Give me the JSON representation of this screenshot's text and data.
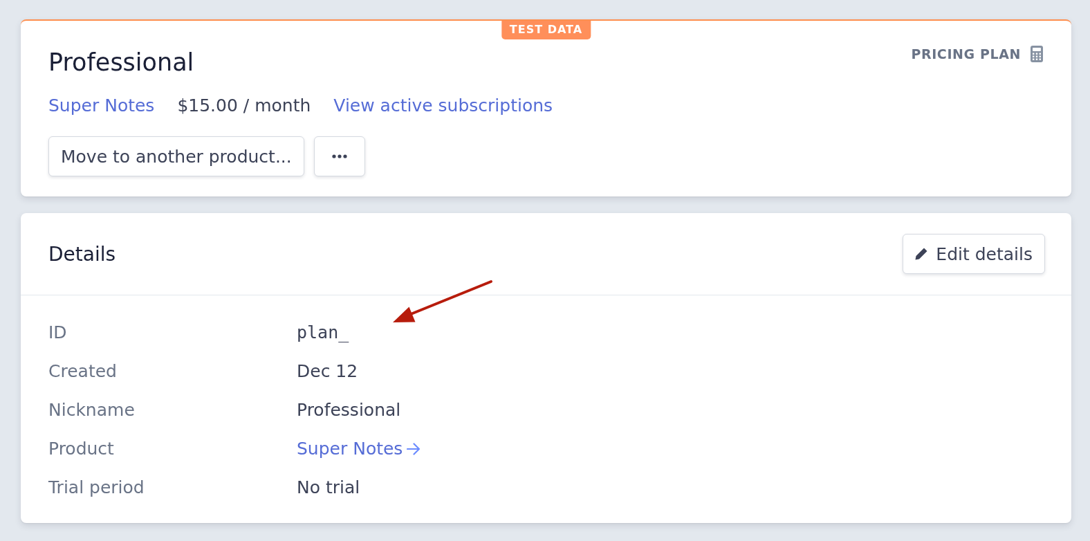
{
  "badge": "TEST DATA",
  "plan": {
    "name": "Professional",
    "type_label": "PRICING PLAN",
    "product_link": "Super Notes",
    "price": "$15.00 / month",
    "subscriptions_link": "View active subscriptions",
    "buttons": [
      {
        "kind": "text",
        "label": "Move to another product..."
      },
      {
        "kind": "more"
      }
    ]
  },
  "details": {
    "title": "Details",
    "edit_button": "Edit details",
    "rows": [
      {
        "label": "ID",
        "kind": "code",
        "value": "plan_"
      },
      {
        "label": "Created",
        "kind": "text",
        "value": "Dec 12"
      },
      {
        "label": "Nickname",
        "kind": "text",
        "value": "Professional"
      },
      {
        "label": "Product",
        "kind": "link",
        "value": "Super Notes"
      },
      {
        "label": "Trial period",
        "kind": "text",
        "value": "No trial"
      }
    ]
  }
}
